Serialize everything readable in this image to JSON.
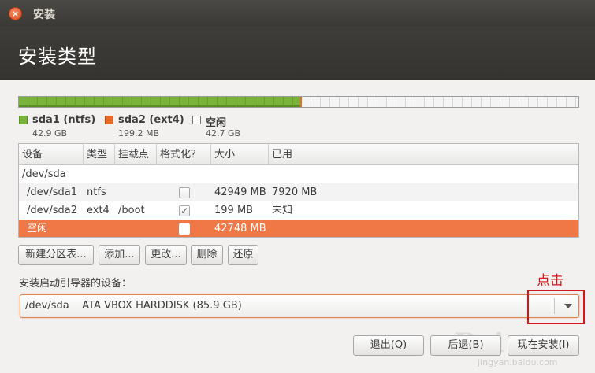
{
  "window": {
    "title": "安装"
  },
  "header": {
    "title": "安装类型"
  },
  "legend": [
    {
      "name": "sda1 (ntfs)",
      "size": "42.9 GB",
      "color": "#7ab33a"
    },
    {
      "name": "sda2 (ext4)",
      "size": "199.2 MB",
      "color": "#e76c25"
    },
    {
      "name": "空闲",
      "size": "42.7 GB",
      "color": "#ffffff"
    }
  ],
  "table": {
    "headers": [
      "设备",
      "类型",
      "挂载点",
      "格式化？",
      "大小",
      "已用"
    ],
    "rows": [
      {
        "device": "/dev/sda",
        "type": "",
        "mount": "",
        "format": null,
        "size": "",
        "used": ""
      },
      {
        "device": "/dev/sda1",
        "type": "ntfs",
        "mount": "",
        "format": false,
        "size": "42949 MB",
        "used": "7920 MB"
      },
      {
        "device": "/dev/sda2",
        "type": "ext4",
        "mount": "/boot",
        "format": true,
        "size": "199 MB",
        "used": "未知"
      },
      {
        "device": "空闲",
        "type": "",
        "mount": "",
        "format": false,
        "size": "42748 MB",
        "used": "",
        "selected": true
      }
    ]
  },
  "partition_buttons": {
    "new_table": "新建分区表...",
    "add": "添加...",
    "change": "更改...",
    "delete": "删除",
    "revert": "还原"
  },
  "bootloader": {
    "label": "安装启动引导器的设备：",
    "device": "/dev/sda",
    "description": "ATA VBOX HARDDISK (85.9 GB)"
  },
  "annotation": {
    "text": "点击"
  },
  "footer": {
    "quit": "退出(Q)",
    "back": "后退(B)",
    "install_now": "现在安装(I)"
  },
  "watermark": {
    "main": "Bai",
    "sub": "jingyan.baidu.com"
  },
  "colors": {
    "accent": "#f07746",
    "used_green": "#7ab33a",
    "sda2_orange": "#e76c25",
    "annotation_red": "#d8141b"
  }
}
